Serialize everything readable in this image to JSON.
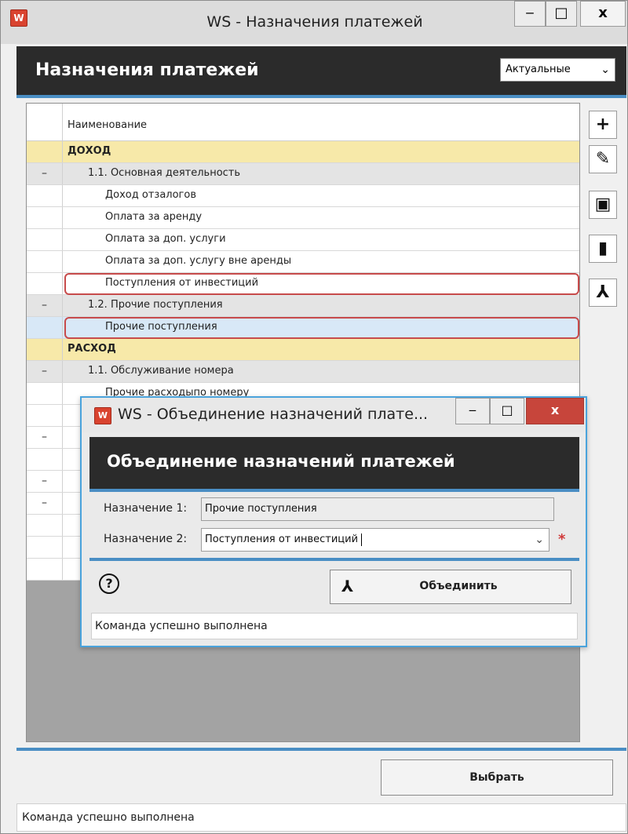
{
  "main_window": {
    "title": "WS - Назначения платежей",
    "app_icon": "ws-logo-icon",
    "controls": {
      "minimize": "‒",
      "maximize": "□",
      "close": "x"
    },
    "header_title": "Назначения платежей",
    "filter": {
      "selected": "Актуальные"
    },
    "column_header": "Наименование",
    "rows": [
      {
        "gutter": "",
        "label": "ДОХОД",
        "kind": "category"
      },
      {
        "gutter": "–",
        "label": "1.1. Основная деятельность",
        "kind": "group"
      },
      {
        "gutter": "",
        "label": "Доход отзалогов",
        "kind": "item"
      },
      {
        "gutter": "",
        "label": "Оплата за аренду",
        "kind": "item"
      },
      {
        "gutter": "",
        "label": "Оплата за доп. услуги",
        "kind": "item"
      },
      {
        "gutter": "",
        "label": "Оплата за доп. услугу вне аренды",
        "kind": "item"
      },
      {
        "gutter": "",
        "label": "Поступления от инвестиций",
        "kind": "item",
        "highlighted": true
      },
      {
        "gutter": "–",
        "label": "1.2. Прочие поступления",
        "kind": "group"
      },
      {
        "gutter": "",
        "label": "Прочие поступления",
        "kind": "item",
        "highlighted": true,
        "selected": true
      },
      {
        "gutter": "",
        "label": "РАСХОД",
        "kind": "category"
      },
      {
        "gutter": "–",
        "label": "1.1. Обслуживание номера",
        "kind": "group"
      },
      {
        "gutter": "",
        "label": "Прочие расходыпо номеру",
        "kind": "item"
      },
      {
        "gutter": "",
        "label": "",
        "kind": "item"
      },
      {
        "gutter": "–",
        "label": "",
        "kind": "item"
      },
      {
        "gutter": "",
        "label": "",
        "kind": "item"
      },
      {
        "gutter": "–",
        "label": "",
        "kind": "item"
      },
      {
        "gutter": "–",
        "label": "",
        "kind": "item"
      },
      {
        "gutter": "",
        "label": "",
        "kind": "item"
      },
      {
        "gutter": "",
        "label": "",
        "kind": "item"
      },
      {
        "gutter": "",
        "label": "",
        "kind": "item"
      }
    ],
    "toolbar": [
      {
        "icon": "plus-icon",
        "glyph": "+"
      },
      {
        "icon": "pencil-icon",
        "glyph": "✎"
      },
      {
        "icon": "archive-icon",
        "glyph": "▣"
      },
      {
        "icon": "trash-icon",
        "glyph": "🗑"
      },
      {
        "icon": "merge-icon",
        "glyph": "⅄"
      }
    ],
    "select_button": "Выбрать",
    "status": "Команда успешно выполнена"
  },
  "dialog": {
    "title": "WS - Объединение назначений плате...",
    "header_title": "Объединение назначений платежей",
    "field1_label": "Назначение 1:",
    "field1_value": "Прочие поступления",
    "field2_label": "Назначение 2:",
    "field2_value": "Поступления от инвестиций",
    "required_mark": "*",
    "help_glyph": "?",
    "merge_button": "Объединить",
    "status": "Команда успешно выполнена"
  },
  "colors": {
    "header_bg": "#2b2b2b",
    "accent": "#4a8ec4",
    "category_row": "#f7e9a9",
    "group_row": "#e4e4e4",
    "highlight_border": "#c74b4b"
  }
}
